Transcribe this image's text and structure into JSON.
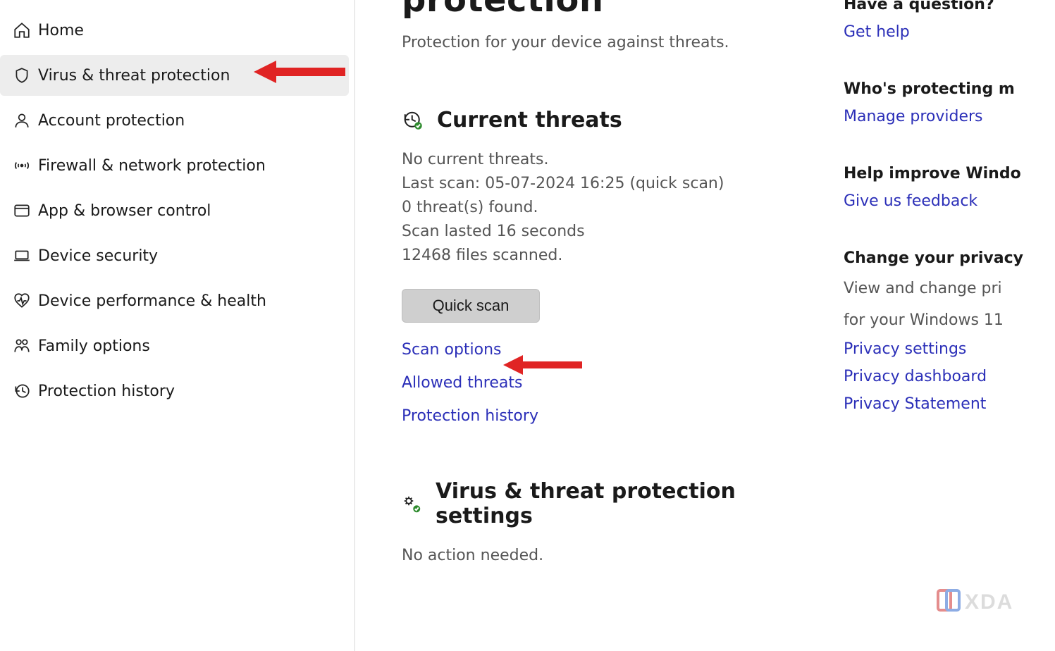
{
  "sidebar": {
    "items": [
      {
        "label": "Home"
      },
      {
        "label": "Virus & threat protection"
      },
      {
        "label": "Account protection"
      },
      {
        "label": "Firewall & network protection"
      },
      {
        "label": "App & browser control"
      },
      {
        "label": "Device security"
      },
      {
        "label": "Device performance & health"
      },
      {
        "label": "Family options"
      },
      {
        "label": "Protection history"
      }
    ]
  },
  "main": {
    "title_cut": "protection",
    "subtitle": "Protection for your device against threats.",
    "current_threats": {
      "heading": "Current threats",
      "line1": "No current threats.",
      "line2": "Last scan: 05-07-2024 16:25 (quick scan)",
      "line3": "0 threat(s) found.",
      "line4": "Scan lasted 16 seconds",
      "line5": "12468 files scanned.",
      "quick_scan": "Quick scan",
      "links": {
        "scan_options": "Scan options",
        "allowed_threats": "Allowed threats",
        "protection_history": "Protection history"
      }
    },
    "settings": {
      "heading": "Virus & threat protection settings",
      "line1": "No action needed."
    }
  },
  "right": {
    "q_title": "Have a question?",
    "q_link": "Get help",
    "who_title": "Who's protecting m",
    "who_link": "Manage providers",
    "help_title": "Help improve Windo",
    "help_link": "Give us feedback",
    "privacy_title": "Change your privacy",
    "privacy_text1": "View and change pri",
    "privacy_text2": "for your Windows 11",
    "privacy_link1": "Privacy settings",
    "privacy_link2": "Privacy dashboard",
    "privacy_link3": "Privacy Statement"
  },
  "watermark": "XDA"
}
